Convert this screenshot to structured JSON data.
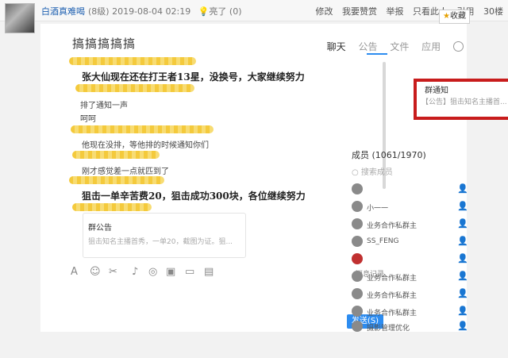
{
  "forum": {
    "author": "白酒真难喝",
    "level": "(8级)",
    "timestamp": "2019-08-04 02:19",
    "bulb": "亮了 (0)",
    "actions": [
      "修改",
      "我要赞赏",
      "举报",
      "只看此人",
      "引用",
      "30楼"
    ],
    "favorite": "收藏"
  },
  "chatwin": {
    "title": "搞搞搞搞搞",
    "tabs": [
      "聊天",
      "公告",
      "文件",
      "应用"
    ],
    "messages": {
      "m1": "张大仙现在还在打王者13星，没换号，大家继续努力",
      "m2": "排了通知一声",
      "m3": "呵呵",
      "m4": "他现在没排，等他排的时候通知你们",
      "m5": "刚才感觉差一点就匹到了",
      "m6": "狙击一单辛苦费20，狙击成功300块，各位继续努力"
    },
    "notice_card": {
      "title": "群公告",
      "desc": "狙击知名主播首秀，一单20，截图为证。狙..."
    },
    "history": "消息记录",
    "send": "发送(S)"
  },
  "side": {
    "notice_title": "群通知",
    "notice_desc": "【公告】狙击知名主播首...",
    "members_title": "成员 (1061/1970)",
    "search_placeholder": "搜索成员",
    "members": [
      "",
      "小一一",
      "业务合作私群主",
      "SS_FENG",
      "",
      "业务合作私群主",
      "业务合作私群主",
      "业务合作私群主",
      "摄影管理优化"
    ]
  }
}
